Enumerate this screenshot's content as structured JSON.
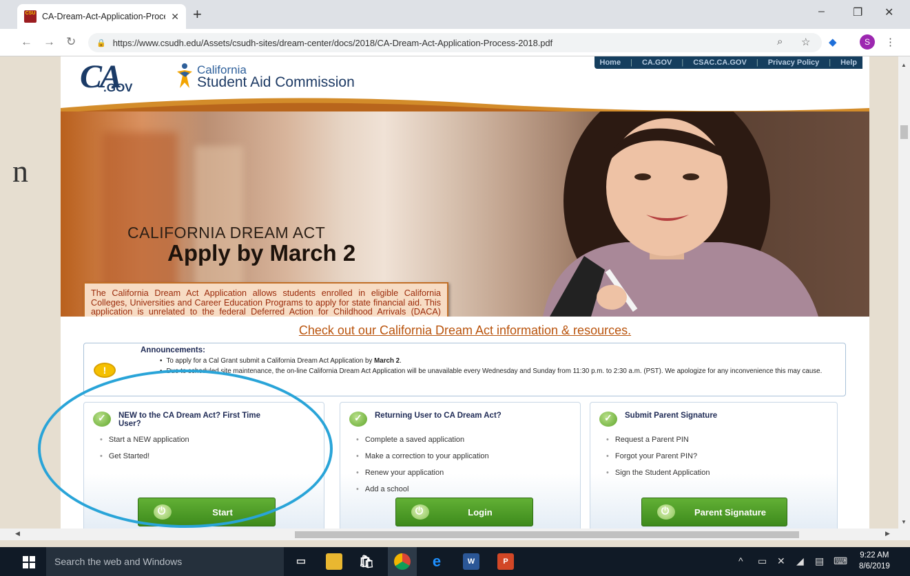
{
  "browser": {
    "tab_title": "CA-Dream-Act-Application-Proce",
    "favicon_text": "CSU",
    "url": "https://www.csudh.edu/Assets/csudh-sites/dream-center/docs/2018/CA-Dream-Act-Application-Process-2018.pdf",
    "profile_initial": "S"
  },
  "slide": {
    "partial_letter": "n"
  },
  "site": {
    "nav": [
      "Home",
      "CA.GOV",
      "CSAC.CA.GOV",
      "Privacy Policy",
      "Help"
    ],
    "ca_logo": "CA",
    "ca_gov": ".GOV",
    "commission_line1": "California",
    "commission_line2": "Student Aid Commission"
  },
  "hero": {
    "subtitle": "CALIFORNIA DREAM ACT",
    "title": "Apply by March 2",
    "description": "The California Dream Act Application allows students enrolled in eligible California Colleges, Universities and Career Education Programs to apply for state financial aid. This application is unrelated to the federal Deferred Action for Childhood Arrivals (DACA) program."
  },
  "info_link": "Check out our California Dream Act information & resources.",
  "announcements": {
    "heading": "Announcements:",
    "item1_pre": "To apply for a Cal Grant submit a California Dream Act Application by ",
    "item1_bold": "March 2",
    "item1_post": ".",
    "item2": "Due to scheduled site maintenance, the on-line California Dream Act Application will be unavailable every Wednesday and Sunday from 11:30 p.m. to 2:30 a.m. (PST). We apologize for any inconvenience this may cause."
  },
  "cards": [
    {
      "title": "NEW to the CA Dream Act? First Time User?",
      "items": [
        "Start a NEW application",
        "Get Started!"
      ],
      "button": "Start"
    },
    {
      "title": "Returning User to CA Dream Act?",
      "items": [
        "Complete a saved application",
        "Make a correction to your application",
        "Renew your application",
        "Add a school"
      ],
      "button": "Login"
    },
    {
      "title": "Submit Parent Signature",
      "items": [
        "Request a Parent PIN",
        "Forgot your Parent PIN?",
        "Sign the Student Application"
      ],
      "button": "Parent Signature"
    }
  ],
  "taskbar": {
    "search_placeholder": "Search the web and Windows",
    "time": "9:22 AM",
    "date": "8/6/2019"
  },
  "colors": {
    "annotation_circle": "#29a4d8",
    "button_green": "#4c9c26",
    "link_orange": "#b9530c"
  }
}
